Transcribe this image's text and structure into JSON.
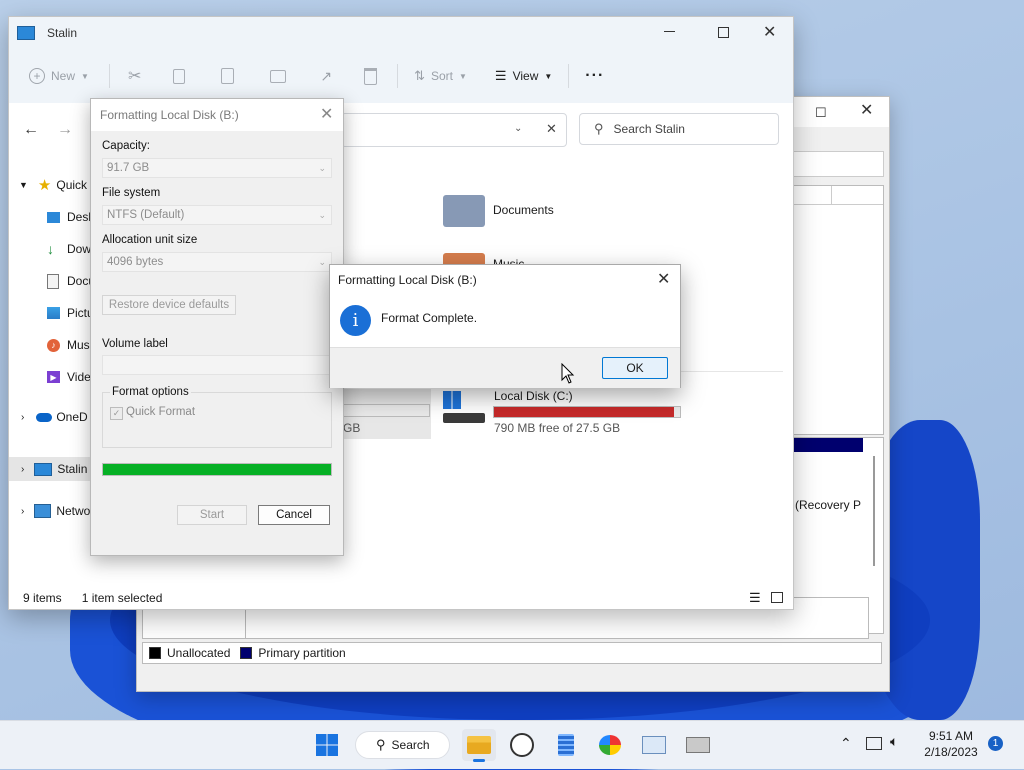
{
  "colors": {
    "accent": "#0078d4",
    "progress_fill": "#06b025",
    "disk_c_bar": "#c62a2a",
    "info_icon": "#1a6fd6"
  },
  "disk_management": {
    "partition_label": "(Recovery P",
    "legend": [
      {
        "label": "Unallocated",
        "color": "#000000"
      },
      {
        "label": "Primary partition",
        "color": "#00006e"
      }
    ]
  },
  "explorer": {
    "title": "Stalin",
    "toolbar": {
      "new_label": "New",
      "sort_label": "Sort",
      "view_label": "View",
      "more_label": "···"
    },
    "search_placeholder": "Search Stalin",
    "nav": [
      {
        "label": "Quick",
        "icon": "star-icon"
      },
      {
        "label": "Desk",
        "icon": "desktop-folder-icon"
      },
      {
        "label": "Dow",
        "icon": "download-icon"
      },
      {
        "label": "Docu",
        "icon": "document-icon"
      },
      {
        "label": "Pictu",
        "icon": "picture-icon"
      },
      {
        "label": "Musi",
        "icon": "music-icon"
      },
      {
        "label": "Vide",
        "icon": "video-icon"
      },
      {
        "label": "OneD",
        "icon": "cloud-icon"
      },
      {
        "label": "Stalin",
        "icon": "pc-icon"
      },
      {
        "label": "Netwo",
        "icon": "network-icon"
      }
    ],
    "folders": {
      "documents": "Documents",
      "music": "Music"
    },
    "drive_b_free": "GB",
    "drive_c": {
      "name": "Local Disk (C:)",
      "free_text": "790 MB free of 27.5 GB",
      "used_fraction": 0.97
    },
    "status": {
      "items": "9 items",
      "selected": "1 item selected"
    }
  },
  "format_dialog": {
    "title": "Formatting Local Disk (B:)",
    "capacity_label": "Capacity:",
    "capacity_value": "91.7 GB",
    "fs_label": "File system",
    "fs_value": "NTFS (Default)",
    "alloc_label": "Allocation unit size",
    "alloc_value": "4096 bytes",
    "restore_label": "Restore device defaults",
    "volume_label": "Volume label",
    "volume_value": "",
    "options_label": "Format options",
    "quick_format_label": "Quick Format",
    "quick_format_checked": true,
    "progress_fraction": 1.0,
    "start_label": "Start",
    "cancel_label": "Cancel"
  },
  "message_box": {
    "title": "Formatting Local Disk (B:)",
    "message": "Format Complete.",
    "ok_label": "OK"
  },
  "taskbar": {
    "search_label": "Search",
    "time": "9:51 AM",
    "date": "2/18/2023",
    "notification_count": "1"
  }
}
